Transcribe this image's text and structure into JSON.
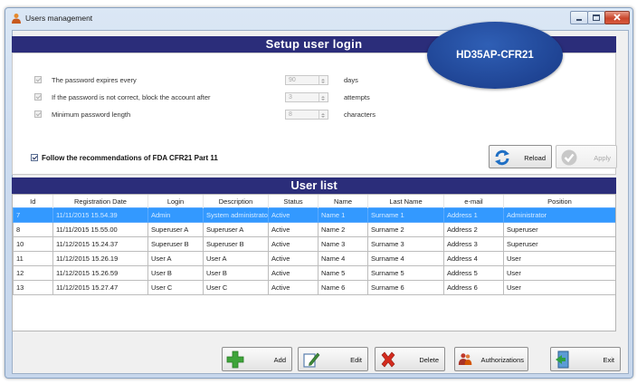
{
  "window": {
    "title": "Users management"
  },
  "setup": {
    "heading": "Setup user login",
    "badge": "HD35AP-CFR21",
    "options": [
      {
        "label": "The password expires every",
        "value": "90",
        "unit": "days",
        "checked": true
      },
      {
        "label": "If the password is not correct, block the account after",
        "value": "3",
        "unit": "attempts",
        "checked": true
      },
      {
        "label": "Minimum password length",
        "value": "8",
        "unit": "characters",
        "checked": true
      }
    ],
    "fda_label": "Follow the recommendations of FDA CFR21 Part 11",
    "fda_checked": true,
    "reload_label": "Reload",
    "apply_label": "Apply"
  },
  "user_list": {
    "heading": "User list",
    "columns": [
      "Id",
      "Registration Date",
      "Login",
      "Description",
      "Status",
      "Name",
      "Last Name",
      "e-mail",
      "Position"
    ],
    "rows": [
      [
        "7",
        "11/11/2015 15.54.39",
        "Admin",
        "System administrator",
        "Active",
        "Name 1",
        "Surname 1",
        "Address 1",
        "Administrator"
      ],
      [
        "8",
        "11/11/2015 15.55.00",
        "Superuser A",
        "Superuser A",
        "Active",
        "Name 2",
        "Surname 2",
        "Address 2",
        "Superuser"
      ],
      [
        "10",
        "11/12/2015 15.24.37",
        "Superuser B",
        "Superuser B",
        "Active",
        "Name 3",
        "Surname 3",
        "Address 3",
        "Superuser"
      ],
      [
        "11",
        "11/12/2015 15.26.19",
        "User A",
        "User A",
        "Active",
        "Name 4",
        "Surname 4",
        "Address 4",
        "User"
      ],
      [
        "12",
        "11/12/2015 15.26.59",
        "User B",
        "User B",
        "Active",
        "Name 5",
        "Surname 5",
        "Address 5",
        "User"
      ],
      [
        "13",
        "11/12/2015 15.27.47",
        "User C",
        "User C",
        "Active",
        "Name 6",
        "Surname 6",
        "Address 6",
        "User"
      ]
    ],
    "selected_row": 0
  },
  "actions": {
    "add_label": "Add",
    "edit_label": "Edit",
    "delete_label": "Delete",
    "authorizations_label": "Authorizations",
    "exit_label": "Exit"
  },
  "colors": {
    "banner": "#2b2d7a",
    "badge": "#1f4494",
    "selection": "#3399ff"
  }
}
